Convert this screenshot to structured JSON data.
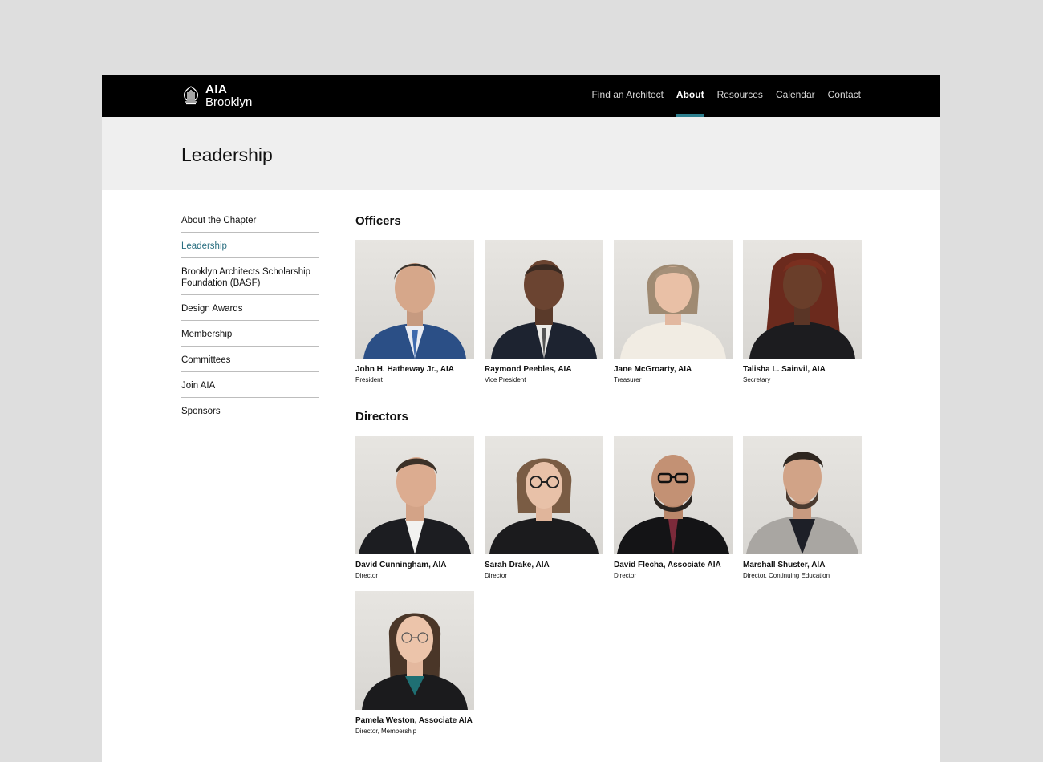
{
  "brand": {
    "line1": "AIA",
    "line2": "Brooklyn",
    "logo_icon": "aia-eagle-logo-icon"
  },
  "nav": {
    "items": [
      {
        "label": "Find an Architect",
        "active": false
      },
      {
        "label": "About",
        "active": true
      },
      {
        "label": "Resources",
        "active": false
      },
      {
        "label": "Calendar",
        "active": false
      },
      {
        "label": "Contact",
        "active": false
      }
    ],
    "active_underline_color": "#2d7f8e"
  },
  "page": {
    "title": "Leadership"
  },
  "sidebar": {
    "items": [
      {
        "label": "About the Chapter",
        "active": false
      },
      {
        "label": "Leadership",
        "active": true
      },
      {
        "label": "Brooklyn Architects Scholarship Foundation (BASF)",
        "active": false
      },
      {
        "label": "Design Awards",
        "active": false
      },
      {
        "label": "Membership",
        "active": false
      },
      {
        "label": "Committees",
        "active": false
      },
      {
        "label": "Join AIA",
        "active": false
      },
      {
        "label": "Sponsors",
        "active": false
      }
    ],
    "active_color": "#2a6f80"
  },
  "officers": {
    "heading": "Officers",
    "people": [
      {
        "name": "John H. Hatheway Jr., AIA",
        "role": "President"
      },
      {
        "name": "Raymond Peebles, AIA",
        "role": "Vice President"
      },
      {
        "name": "Jane McGroarty, AIA",
        "role": "Treasurer"
      },
      {
        "name": "Talisha L. Sainvil, AIA",
        "role": "Secretary"
      }
    ]
  },
  "directors": {
    "heading": "Directors",
    "people": [
      {
        "name": "David Cunningham, AIA",
        "role": "Director"
      },
      {
        "name": "Sarah Drake, AIA",
        "role": "Director"
      },
      {
        "name": "David Flecha, Associate AIA",
        "role": "Director"
      },
      {
        "name": "Marshall Shuster, AIA",
        "role": "Director, Continuing Education"
      },
      {
        "name": "Pamela Weston, Associate AIA",
        "role": "Director, Membership"
      }
    ]
  }
}
